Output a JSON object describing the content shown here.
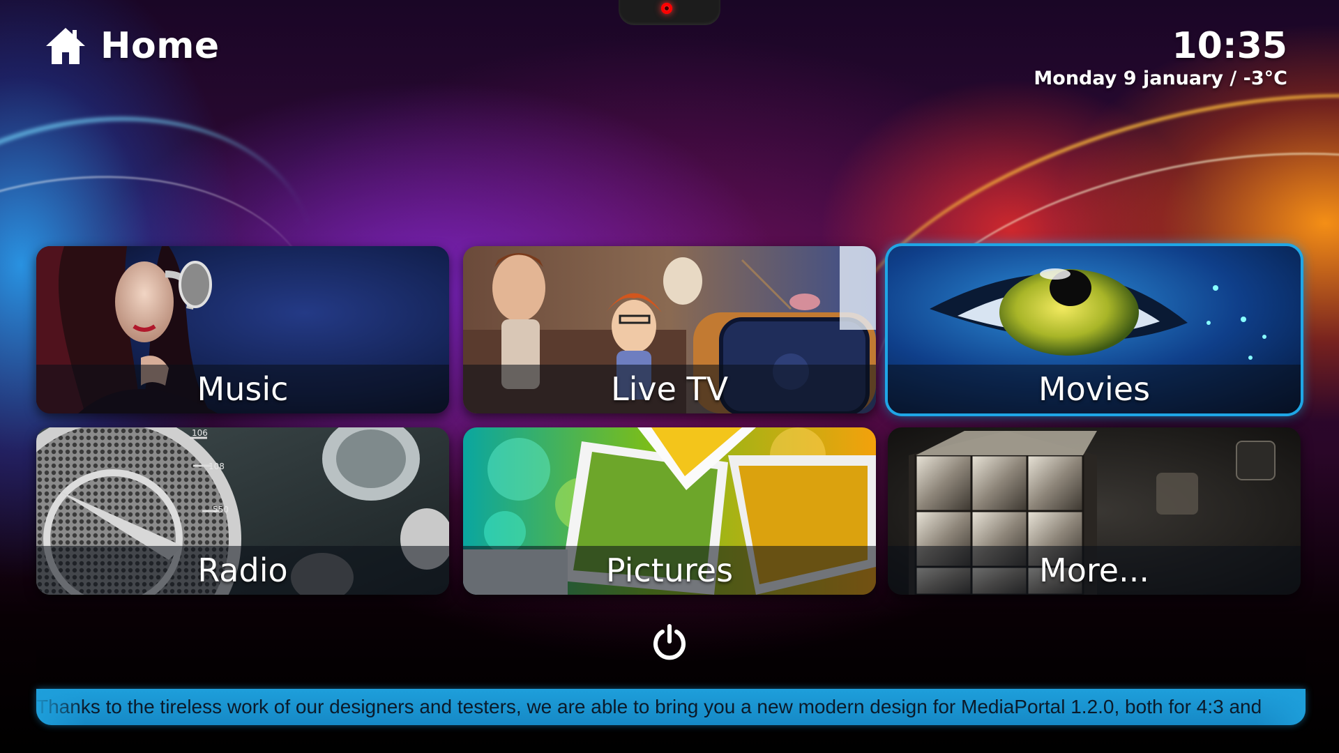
{
  "header": {
    "title": "Home",
    "icon": "home-icon"
  },
  "clock": {
    "time": "10:35",
    "date": "Monday 9 january / -3°C"
  },
  "tiles": [
    {
      "label": "Music",
      "focused": false,
      "icon": "headphones-artwork"
    },
    {
      "label": "Live TV",
      "focused": false,
      "icon": "tv-artwork"
    },
    {
      "label": "Movies",
      "focused": true,
      "icon": "eye-artwork"
    },
    {
      "label": "Radio",
      "focused": false,
      "icon": "radio-dial-artwork"
    },
    {
      "label": "Pictures",
      "focused": false,
      "icon": "photo-stack-artwork"
    },
    {
      "label": "More...",
      "focused": false,
      "icon": "cubes-artwork"
    }
  ],
  "footer": {
    "power_icon": "power-icon",
    "ticker": "Thanks to the tireless work of our designers and testers, we are able to bring you a new modern design for MediaPortal 1.2.0, both for 4:3 and"
  },
  "colors": {
    "accent": "#1fa6e6",
    "ticker_bg": "#1e9fdb",
    "text": "#ffffff"
  }
}
